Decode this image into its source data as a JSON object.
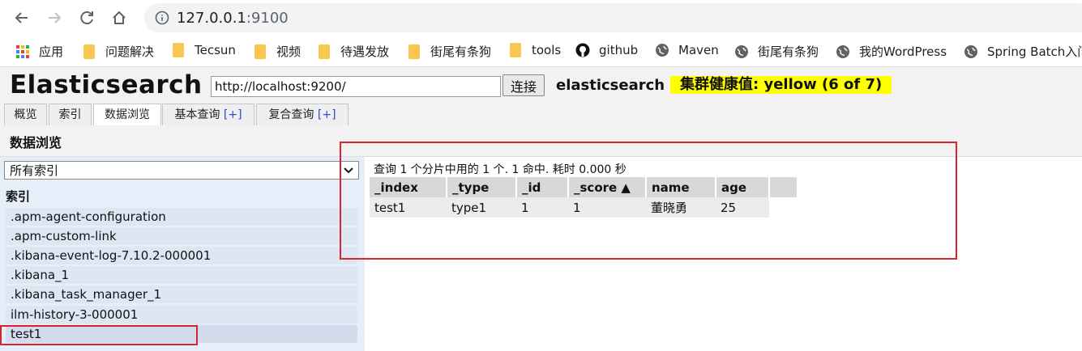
{
  "browser": {
    "url_host": "127.0.0.1",
    "url_port": ":9100"
  },
  "bookmarks": [
    {
      "icon": "apps-grid-icon",
      "label": "应用"
    },
    {
      "icon": "folder-icon",
      "label": "问题解决"
    },
    {
      "icon": "folder-icon",
      "label": "Tecsun"
    },
    {
      "icon": "folder-icon",
      "label": "视频"
    },
    {
      "icon": "folder-icon",
      "label": "待遇发放"
    },
    {
      "icon": "folder-icon",
      "label": "街尾有条狗"
    },
    {
      "icon": "folder-icon",
      "label": "tools"
    },
    {
      "icon": "github-icon",
      "label": "github"
    },
    {
      "icon": "globe-icon",
      "label": "Maven"
    },
    {
      "icon": "globe-icon",
      "label": "街尾有条狗"
    },
    {
      "icon": "globe-icon",
      "label": "我的WordPress"
    },
    {
      "icon": "globe-icon",
      "label": "Spring Batch入门"
    }
  ],
  "app": {
    "title": "Elasticsearch",
    "server_url": "http://localhost:9200/",
    "connect_label": "连接",
    "cluster_name": "elasticsearch",
    "health": "集群健康值: yellow (6 of 7)",
    "health_color": "#ffff00"
  },
  "tabs": [
    {
      "label": "概览",
      "plus": ""
    },
    {
      "label": "索引",
      "plus": ""
    },
    {
      "label": "数据浏览",
      "plus": ""
    },
    {
      "label": "基本查询",
      "plus": "[+]"
    },
    {
      "label": "复合查询",
      "plus": "[+]"
    }
  ],
  "section_title": "数据浏览",
  "sidebar": {
    "select_value": "所有索引",
    "indices_heading": "索引",
    "indices": [
      ".apm-agent-configuration",
      ".apm-custom-link",
      ".kibana-event-log-7.10.2-000001",
      ".kibana_1",
      ".kibana_task_manager_1",
      "ilm-history-3-000001",
      "test1"
    ]
  },
  "results": {
    "summary": "查询 1 个分片中用的 1 个. 1 命中. 耗时 0.000 秒",
    "columns": [
      "_index",
      "_type",
      "_id",
      "_score ▲",
      "name",
      "age"
    ],
    "rows": [
      [
        "test1",
        "type1",
        "1",
        "1",
        "董晓勇",
        "25"
      ]
    ]
  },
  "annotation_color": "#d9232e"
}
